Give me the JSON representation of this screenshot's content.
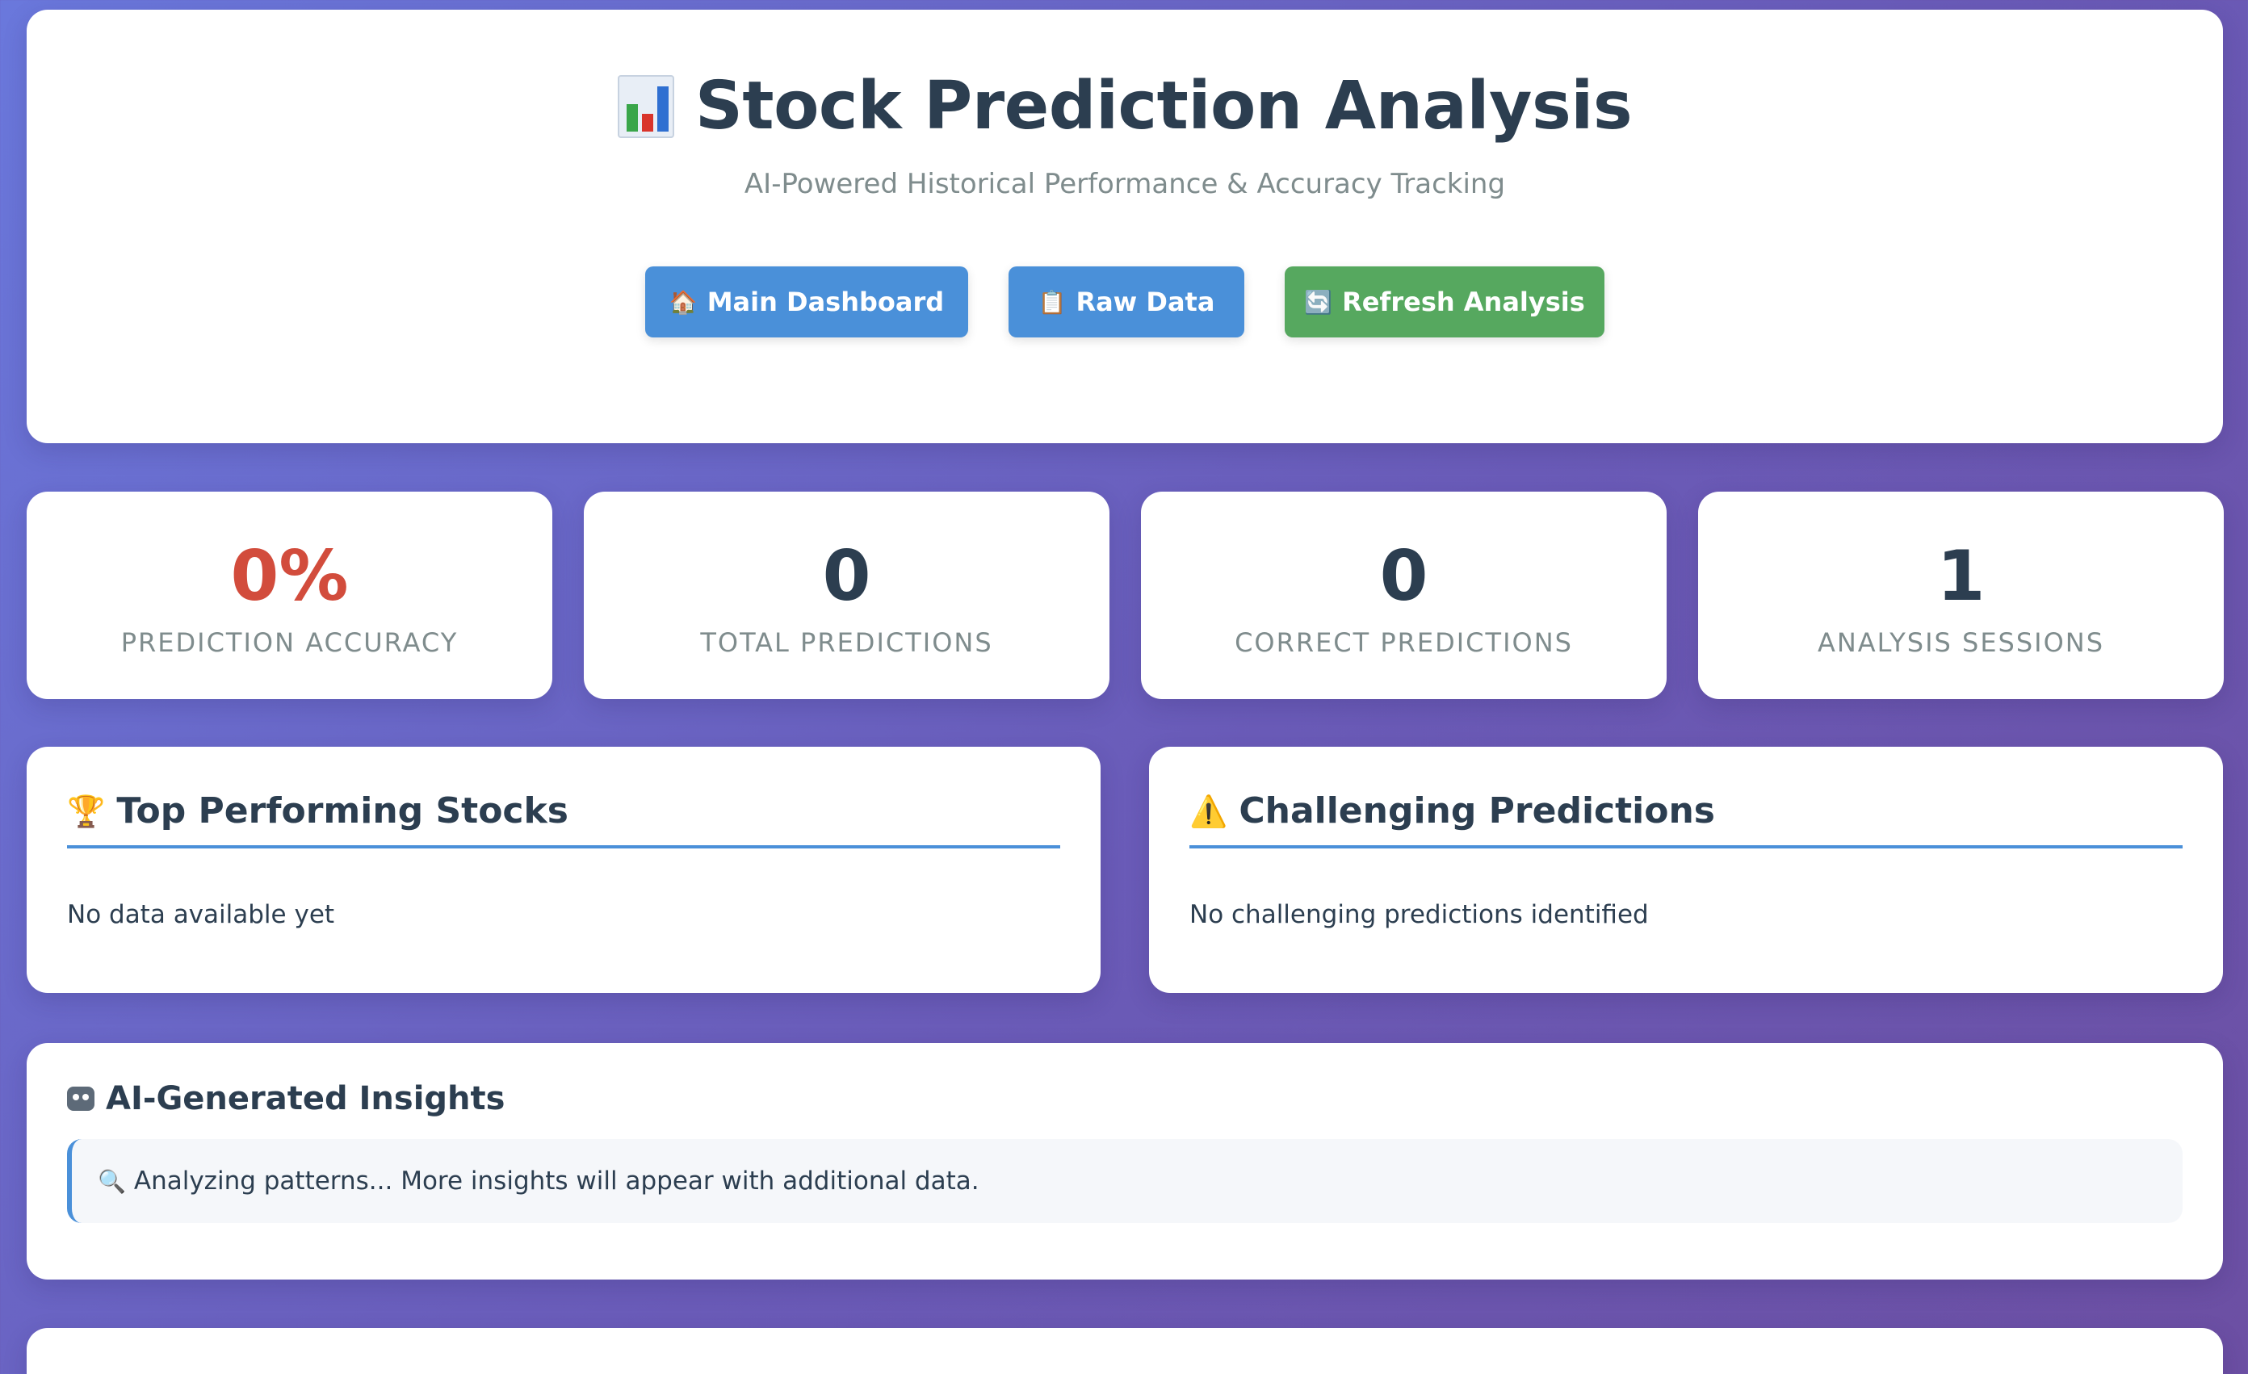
{
  "header": {
    "title": "Stock Prediction Analysis",
    "title_icon": "bar-chart-icon",
    "subtitle": "AI-Powered Historical Performance & Accuracy Tracking",
    "buttons": {
      "dashboard": "Main Dashboard",
      "raw": "Raw Data",
      "refresh": "Refresh Analysis"
    },
    "button_icons": {
      "dashboard": "🏠",
      "raw": "📋",
      "refresh": "🔄"
    }
  },
  "stats": [
    {
      "value": "0%",
      "label": "Prediction Accuracy",
      "color": "#d24c3c"
    },
    {
      "value": "0",
      "label": "Total Predictions"
    },
    {
      "value": "0",
      "label": "Correct Predictions"
    },
    {
      "value": "1",
      "label": "Analysis Sessions"
    }
  ],
  "panels": {
    "top": {
      "icon": "🏆",
      "title": "Top Performing Stocks",
      "body": "No data available yet"
    },
    "challenging": {
      "icon": "⚠️",
      "title": "Challenging Predictions",
      "body": "No challenging predictions identified"
    }
  },
  "insights": {
    "icon": "robot-icon",
    "title": "AI-Generated Insights",
    "message_icon": "🔍",
    "message": "Analyzing patterns... More insights will appear with additional data."
  },
  "colors": {
    "accent": "#4a90d9",
    "success": "#56a85f",
    "danger": "#d24c3c",
    "text": "#2c3e50",
    "muted": "#7f8c8d"
  }
}
